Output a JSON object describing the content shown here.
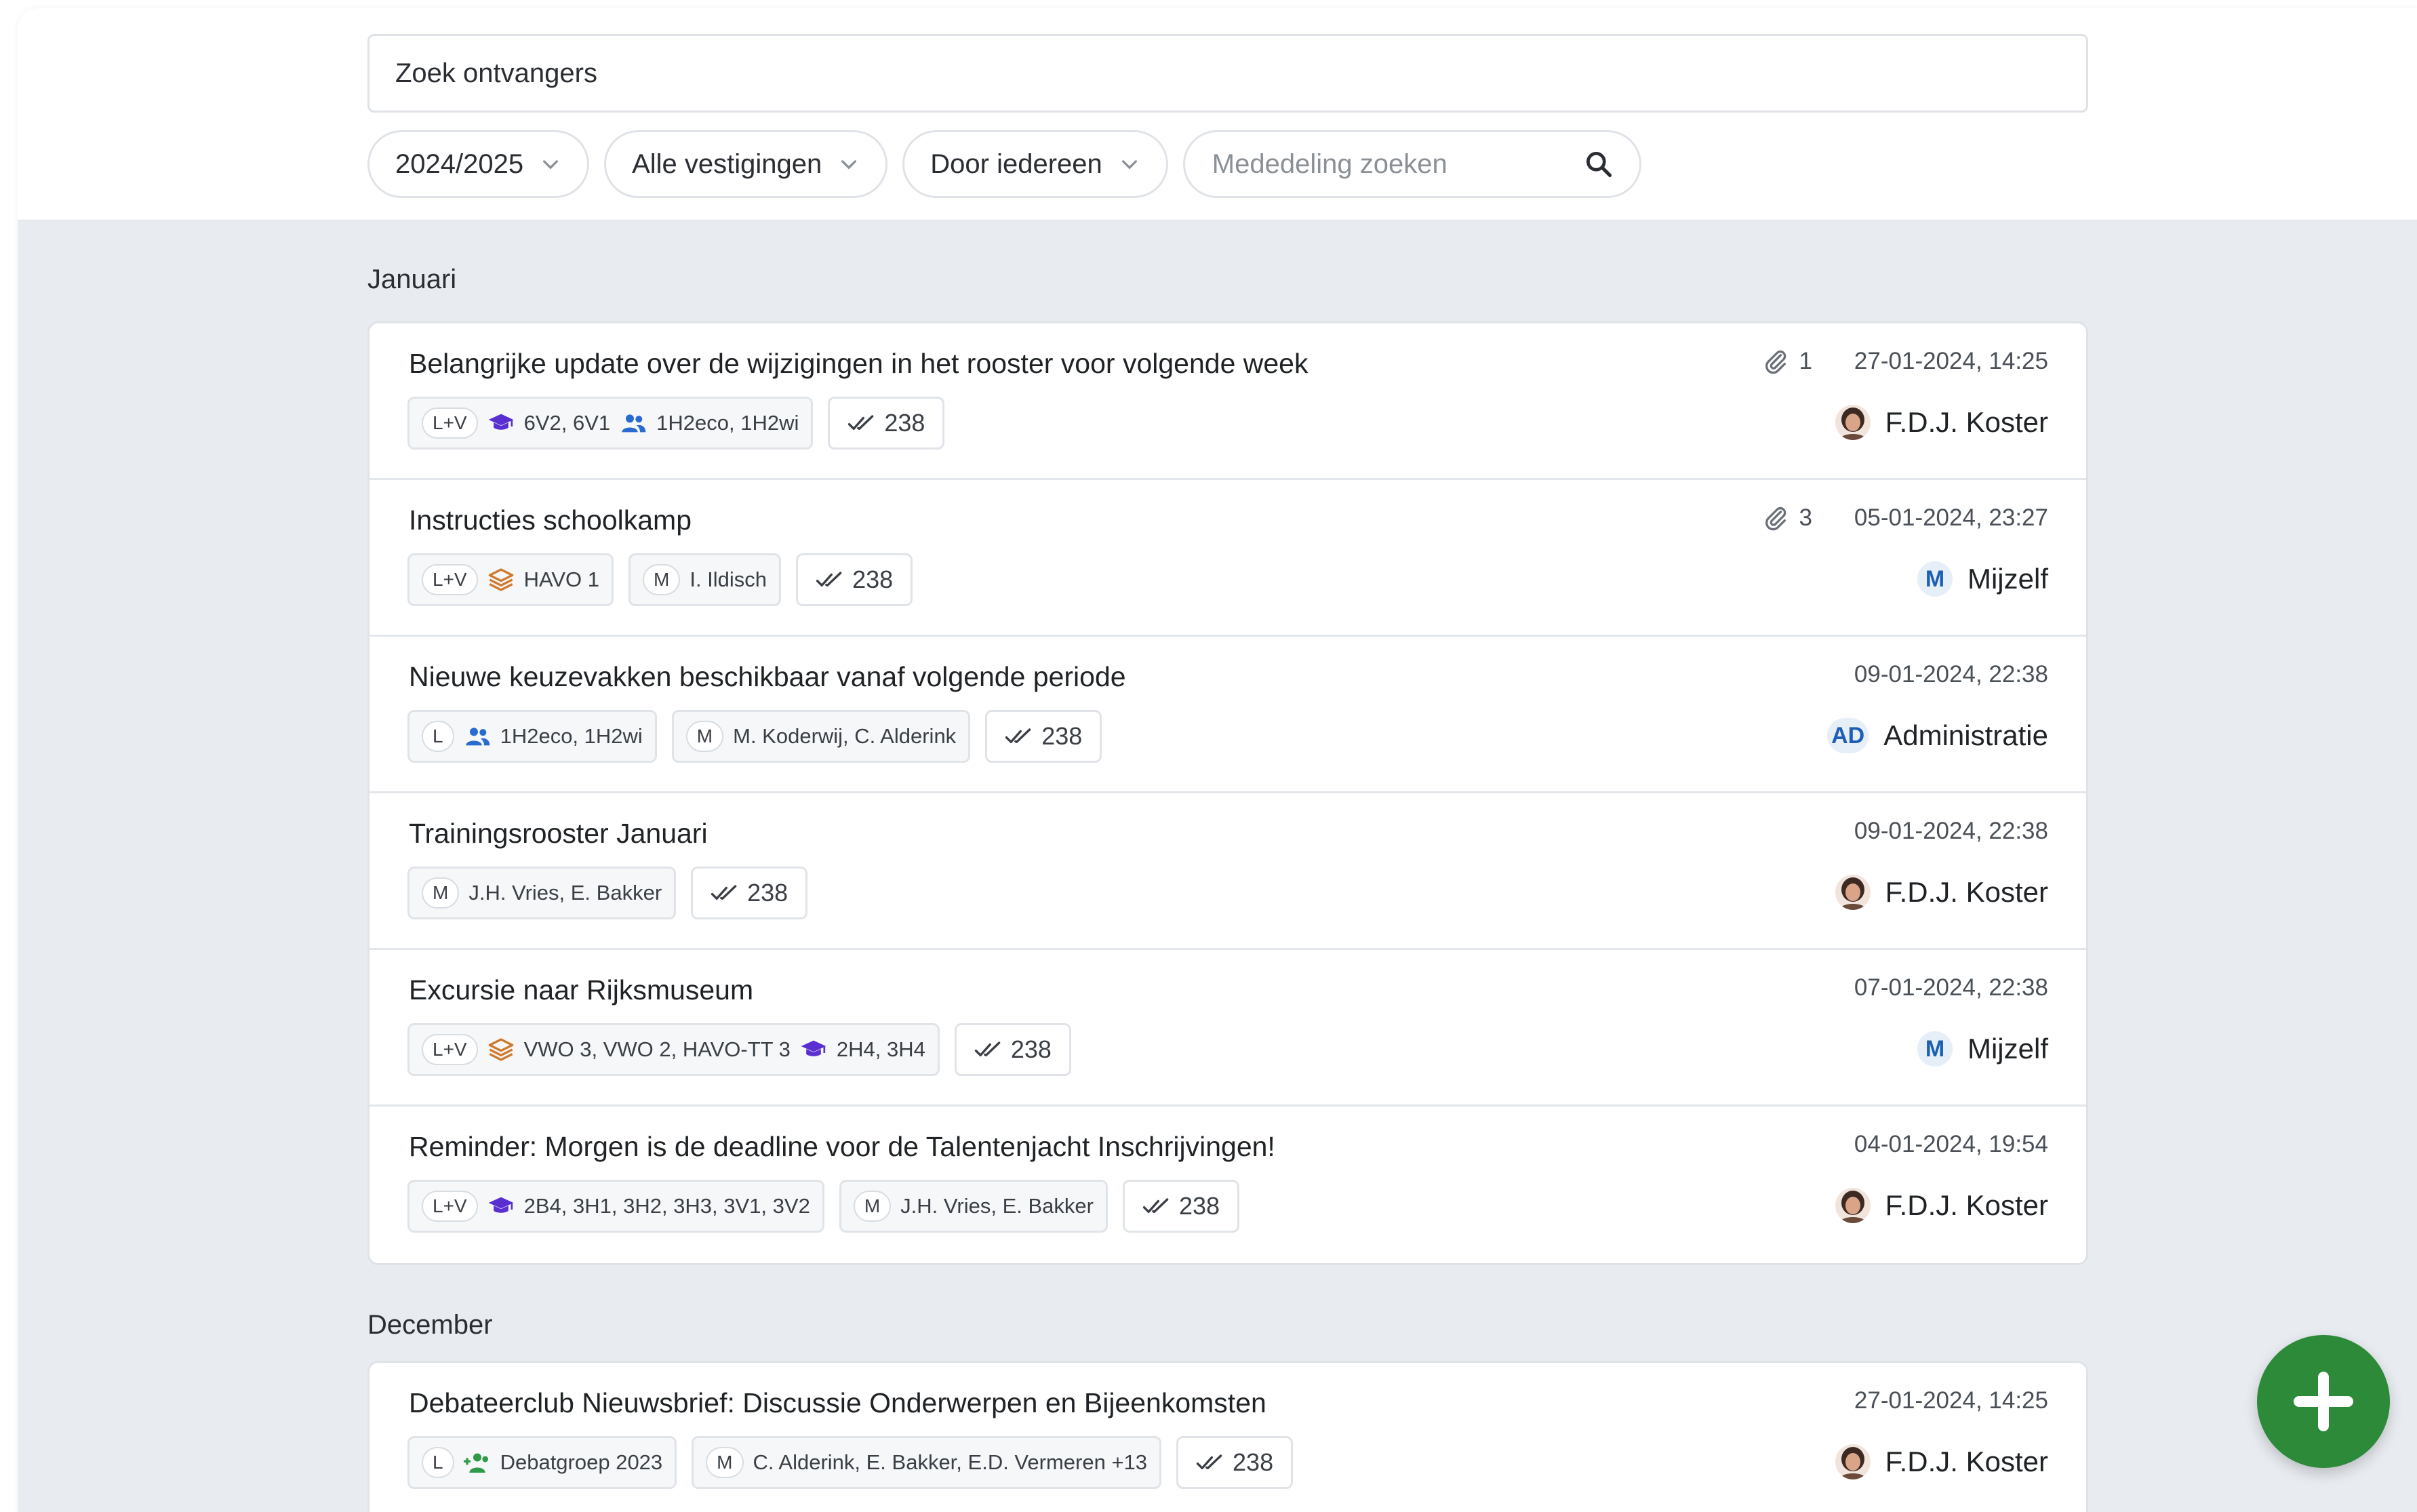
{
  "search": {
    "recipients_placeholder": "Zoek ontvangers",
    "message_placeholder": "Mededeling zoeken"
  },
  "filters": {
    "year": "2024/2025",
    "location": "Alle vestigingen",
    "author": "Door iedereen"
  },
  "months": [
    {
      "label": "Januari",
      "items": [
        {
          "title": "Belangrijke update over de wijzigingen in het rooster voor volgende week",
          "attachments": "1",
          "date": "27-01-2024, 14:25",
          "author": "F.D.J. Koster",
          "tags": [
            {
              "code": "L+V",
              "groups": [
                {
                  "icon": "graduation-cap-icon",
                  "text": "6V2, 6V1"
                },
                {
                  "icon": "people-icon",
                  "text": "1H2eco, 1H2wi"
                }
              ]
            }
          ],
          "read_count": "238"
        },
        {
          "title": "Instructies schoolkamp",
          "attachments": "3",
          "date": "05-01-2024, 23:27",
          "author": "Mijzelf",
          "author_initials": "M",
          "tags": [
            {
              "code": "L+V",
              "groups": [
                {
                  "icon": "layers-icon",
                  "text": "HAVO 1"
                }
              ]
            },
            {
              "code": "M",
              "groups": [
                {
                  "text": "I. Ildisch"
                }
              ]
            }
          ],
          "read_count": "238"
        },
        {
          "title": "Nieuwe keuzevakken beschikbaar vanaf volgende periode",
          "date": "09-01-2024, 22:38",
          "author": "Administratie",
          "author_initials": "AD",
          "tags": [
            {
              "code": "L",
              "groups": [
                {
                  "icon": "people-icon",
                  "text": "1H2eco, 1H2wi"
                }
              ]
            },
            {
              "code": "M",
              "groups": [
                {
                  "text": "M. Koderwij, C. Alderink"
                }
              ]
            }
          ],
          "read_count": "238"
        },
        {
          "title": "Trainingsrooster Januari",
          "date": "09-01-2024, 22:38",
          "author": "F.D.J. Koster",
          "tags": [
            {
              "code": "M",
              "groups": [
                {
                  "text": "J.H. Vries, E. Bakker"
                }
              ]
            }
          ],
          "read_count": "238"
        },
        {
          "title": "Excursie naar Rijksmuseum",
          "date": "07-01-2024, 22:38",
          "author": "Mijzelf",
          "author_initials": "M",
          "tags": [
            {
              "code": "L+V",
              "groups": [
                {
                  "icon": "layers-icon",
                  "text": "VWO 3, VWO 2, HAVO-TT 3"
                },
                {
                  "icon": "graduation-cap-icon",
                  "text": "2H4, 3H4"
                }
              ]
            }
          ],
          "read_count": "238"
        },
        {
          "title": "Reminder: Morgen is de deadline voor de Talentenjacht Inschrijvingen!",
          "date": "04-01-2024, 19:54",
          "author": "F.D.J. Koster",
          "tags": [
            {
              "code": "L+V",
              "groups": [
                {
                  "icon": "graduation-cap-icon",
                  "text": "2B4, 3H1, 3H2, 3H3, 3V1, 3V2"
                }
              ]
            },
            {
              "code": "M",
              "groups": [
                {
                  "text": "J.H. Vries, E. Bakker"
                }
              ]
            }
          ],
          "read_count": "238"
        }
      ]
    },
    {
      "label": "December",
      "items": [
        {
          "title": "Debateerclub Nieuwsbrief: Discussie Onderwerpen en Bijeenkomsten",
          "date": "27-01-2024, 14:25",
          "author": "F.D.J. Koster",
          "tags": [
            {
              "code": "L",
              "groups": [
                {
                  "icon": "group-add-icon",
                  "text": "Debatgroep 2023"
                }
              ]
            },
            {
              "code": "M",
              "groups": [
                {
                  "text": "C. Alderink, E. Bakker, E.D. Vermeren +13"
                }
              ]
            }
          ],
          "read_count": "238"
        }
      ]
    }
  ],
  "colors": {
    "accent_blue": "#1c5fb5",
    "cap_purple": "#5a2fd1",
    "people_blue": "#2a6bd1",
    "layers_orange": "#d07a2e",
    "group_green": "#2e9a4a",
    "fab_green": "#2d8a39"
  }
}
